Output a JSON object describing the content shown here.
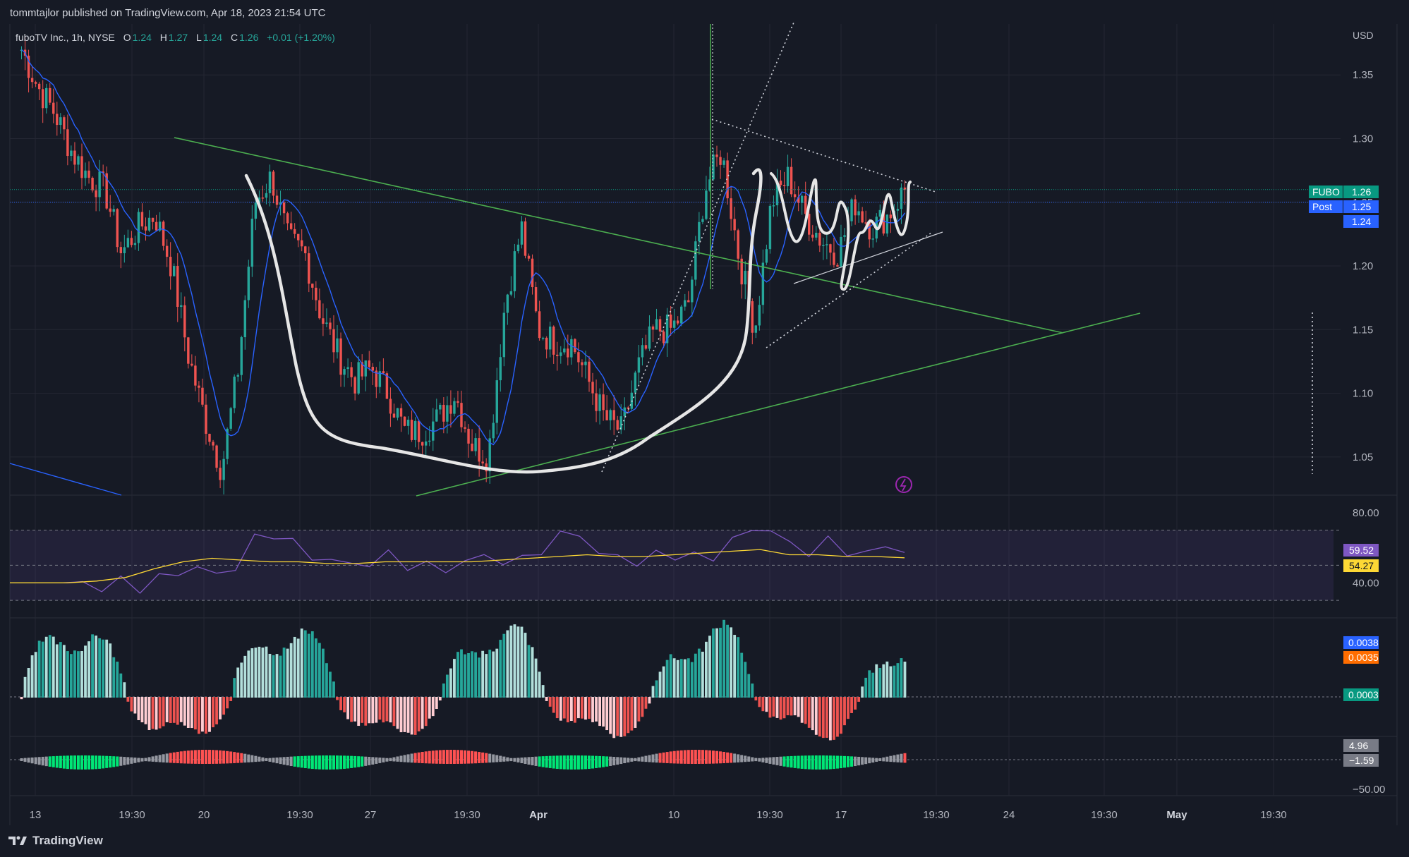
{
  "publisher": "tommtajlor published on TradingView.com, Apr 18, 2023 21:54 UTC",
  "legend": {
    "symbol": "fuboTV Inc., 1h, NYSE",
    "o_label": "O",
    "o": "1.24",
    "h_label": "H",
    "h": "1.27",
    "l_label": "L",
    "l": "1.24",
    "c_label": "C",
    "c": "1.26",
    "change": "+0.01 (+1.20%)"
  },
  "footer": {
    "brand": "TradingView"
  },
  "colors": {
    "background": "#161a25",
    "grid": "#242733",
    "up": "#26a69a",
    "down": "#ef5350",
    "ma": "#2962ff",
    "trendline": "#4caf50",
    "rsi": "#7e57c2",
    "rsi_ma": "#fdd835",
    "macd_line": "#2962ff",
    "signal_line": "#ff6d00"
  },
  "chart_data": [
    {
      "type": "candlestick",
      "title": "",
      "currency": "USD",
      "ylim": [
        1.02,
        1.39
      ],
      "y_ticks": [
        "1.35",
        "1.30",
        "1.25",
        "1.20",
        "1.15",
        "1.10",
        "1.05"
      ],
      "x_ticks": [
        "13",
        "19:30",
        "20",
        "19:30",
        "27",
        "19:30",
        "Apr",
        "10",
        "19:30",
        "17",
        "19:30",
        "24",
        "19:30",
        "May",
        "19:30"
      ],
      "price_tags": [
        {
          "label": "FUBO",
          "value": "1.26",
          "color": "#089981"
        },
        {
          "label": "Post",
          "value": "1.25",
          "color": "#2962ff"
        },
        {
          "label": "",
          "value": "1.24",
          "color": "#2962ff"
        }
      ],
      "ohlc_close_path": [
        1.37,
        1.34,
        1.32,
        1.29,
        1.27,
        1.26,
        1.21,
        1.23,
        1.24,
        1.2,
        1.13,
        1.08,
        1.04,
        1.12,
        1.25,
        1.27,
        1.22,
        1.21,
        1.16,
        1.13,
        1.11,
        1.12,
        1.1,
        1.07,
        1.07,
        1.08,
        1.1,
        1.06,
        1.05,
        1.17,
        1.23,
        1.15,
        1.14,
        1.14,
        1.11,
        1.08,
        1.07,
        1.12,
        1.15,
        1.15,
        1.17,
        1.26,
        1.29,
        1.21,
        1.15,
        1.25,
        1.27,
        1.24,
        1.22,
        1.21,
        1.25,
        1.23,
        1.24,
        1.26
      ],
      "annotations": {
        "dotted_price_marker_value": 1.16
      }
    },
    {
      "type": "line",
      "title": "",
      "ylim": [
        20,
        90
      ],
      "y_ticks": [
        "80.00",
        "40.00"
      ],
      "series": [
        {
          "values": [
            40,
            39,
            38,
            40,
            38,
            42,
            46,
            49,
            44,
            50,
            64,
            69,
            62,
            55,
            53,
            50,
            52,
            55,
            51,
            49,
            48,
            52,
            55,
            53,
            52,
            60,
            66,
            69,
            56,
            55,
            52,
            55,
            57,
            54,
            55,
            65,
            69,
            72,
            60,
            59,
            63,
            58,
            57,
            60,
            59.5
          ]
        },
        {
          "values": [
            40,
            40,
            40,
            41,
            43,
            48,
            52,
            54,
            53,
            52,
            52,
            51,
            51,
            52,
            52,
            52,
            52,
            53,
            54,
            55,
            56,
            55,
            55,
            56,
            57,
            58,
            59,
            56,
            56,
            55,
            55,
            54.27
          ]
        }
      ],
      "tags": [
        {
          "value": "59.52",
          "color": "#7e57c2"
        },
        {
          "value": "54.27",
          "color": "#fdd835"
        }
      ]
    },
    {
      "type": "bar",
      "title": "",
      "tags": [
        {
          "value": "0.0038",
          "color": "#2962ff"
        },
        {
          "value": "0.0035",
          "color": "#ff6d00"
        },
        {
          "value": "0.0003",
          "color": "#089981"
        }
      ]
    },
    {
      "type": "bar",
      "title": "",
      "y_ticks": [
        "−50.00"
      ],
      "tags": [
        {
          "value": "4.96",
          "color": "#787b86"
        },
        {
          "value": "−1.59",
          "color": "#787b86"
        }
      ]
    }
  ]
}
